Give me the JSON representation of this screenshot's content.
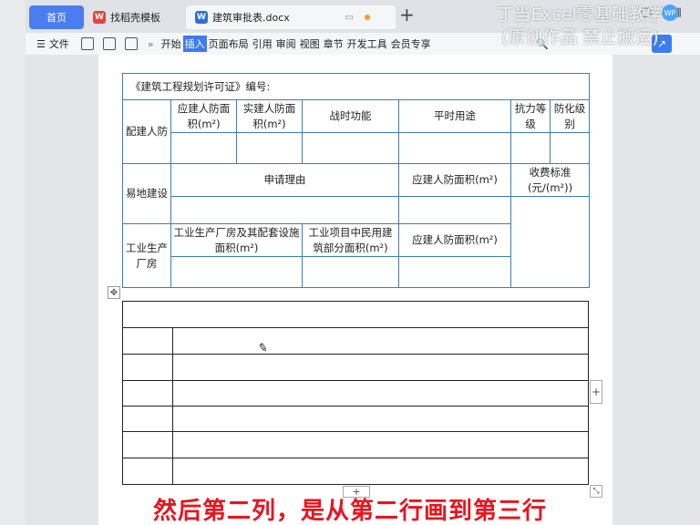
{
  "tabs": {
    "home": "首页",
    "template": "找稻壳模板",
    "document": "建筑审批表.docx",
    "add": "+"
  },
  "watermark": {
    "line1": "丁当Excel零基础教学",
    "line2": "(原创作品 禁止搬运)"
  },
  "ribbon": {
    "file": "文件",
    "items": [
      "开始",
      "插入",
      "页面布局",
      "引用",
      "审阅",
      "视图",
      "章节",
      "开发工具",
      "会员专享"
    ],
    "active": "插入"
  },
  "permit_table": {
    "title": "《建筑工程规划许可证》编号:",
    "row_header_1": "配建人防",
    "col_required_area": "应建人防面积(m²)",
    "col_actual_area": "实建人防面积(m²)",
    "col_wartime": "战时功能",
    "col_peacetime": "平时用途",
    "col_resistance": "抗力等级",
    "col_antichem": "防化级别",
    "row_header_2": "易地建设",
    "col_reason": "申请理由",
    "col_required_area_2": "应建人防面积(m²)",
    "col_fee": "收费标准(元/(m²))",
    "row_header_3": "工业生产厂房",
    "col_industrial": "工业生产厂房及其配套设施面积(m²)",
    "col_civil": "工业项目中民用建筑部分面积(m²)",
    "col_required_area_3": "应建人防面积(m²)"
  },
  "subtitle": "然后第二列，是从第二行画到第三行",
  "colors": {
    "accent": "#3d7bf0",
    "table_border": "#3c7fb1",
    "subtitle": "#e8141e"
  }
}
